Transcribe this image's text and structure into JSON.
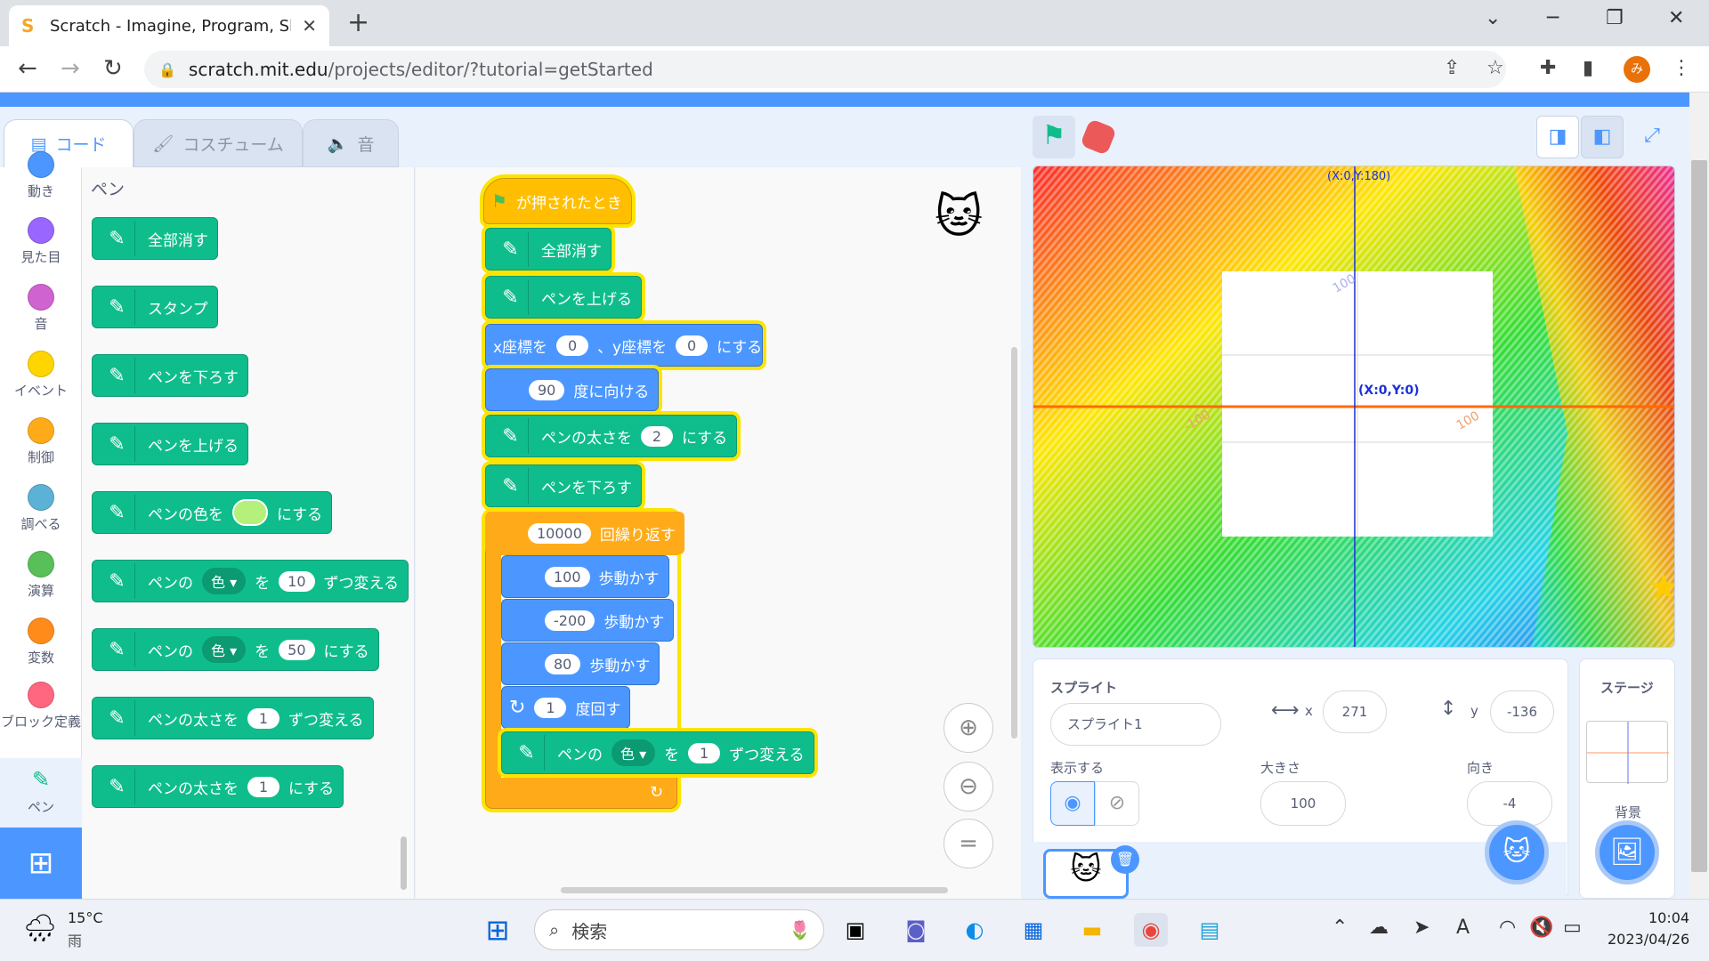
{
  "browser": {
    "tab_title": "Scratch - Imagine, Program, Share",
    "url_host": "scratch.mit.edu",
    "url_path": "/projects/editor/?tutorial=getStarted",
    "profile_initial": "み"
  },
  "editor_tabs": [
    "コード",
    "コスチューム",
    "音"
  ],
  "categories": [
    {
      "label": "動き",
      "color": "#4c97ff"
    },
    {
      "label": "見た目",
      "color": "#9966ff"
    },
    {
      "label": "音",
      "color": "#cf63cf"
    },
    {
      "label": "イベント",
      "color": "#ffd500"
    },
    {
      "label": "制御",
      "color": "#ffab19"
    },
    {
      "label": "調べる",
      "color": "#5cb1d6"
    },
    {
      "label": "演算",
      "color": "#59c059"
    },
    {
      "label": "変数",
      "color": "#ff8c1a"
    },
    {
      "label": "ブロック定義",
      "color": "#ff6680"
    },
    {
      "label": "ペン",
      "color": "#0fbd8c"
    }
  ],
  "palette": {
    "heading": "ペン",
    "b1": "全部消す",
    "b2": "スタンプ",
    "b3": "ペンを下ろす",
    "b4": "ペンを上げる",
    "b5a": "ペンの色を",
    "b5b": "にする",
    "b6a": "ペンの",
    "b6d": "色",
    "b6b": "を",
    "b6v": "10",
    "b6c": "ずつ変える",
    "b7a": "ペンの",
    "b7d": "色",
    "b7b": "を",
    "b7v": "50",
    "b7c": "にする",
    "b8a": "ペンの太さを",
    "b8v": "1",
    "b8b": "ずつ変える",
    "b9a": "ペンの太さを",
    "b9v": "1",
    "b9b": "にする"
  },
  "script": {
    "hat": "が押されたとき",
    "s1": "全部消す",
    "s2": "ペンを上げる",
    "s3a": "x座標を",
    "s3x": "0",
    "s3b": "、y座標を",
    "s3y": "0",
    "s3c": "にする",
    "s4v": "90",
    "s4": "度に向ける",
    "s5a": "ペンの太さを",
    "s5v": "2",
    "s5b": "にする",
    "s6": "ペンを下ろす",
    "s7v": "10000",
    "s7": "回繰り返す",
    "s8v": "100",
    "s8": "歩動かす",
    "s9v": "-200",
    "s9": "歩動かす",
    "s10v": "80",
    "s10": "歩動かす",
    "s11v": "1",
    "s11": "度回す",
    "s12a": "ペンの",
    "s12d": "色",
    "s12b": "を",
    "s12v": "1",
    "s12c": "ずつ変える"
  },
  "stage": {
    "center_label": "(X:0,Y:0)",
    "top_label": "(X:0,Y:180)",
    "tick_100": "100",
    "tick_m100": "-100"
  },
  "sprite": {
    "section": "スプライト",
    "name": "スプライト1",
    "x_label": "x",
    "x": "271",
    "y_label": "y",
    "y": "-136",
    "show_label": "表示する",
    "size_label": "大きさ",
    "size": "100",
    "direction_label": "向き",
    "direction": "-4"
  },
  "stage_pane": {
    "title": "ステージ",
    "backdrop_label": "背景"
  },
  "taskbar": {
    "temp": "15°C",
    "weather": "雨",
    "search": "検索",
    "time": "10:04",
    "date": "2023/04/26"
  }
}
